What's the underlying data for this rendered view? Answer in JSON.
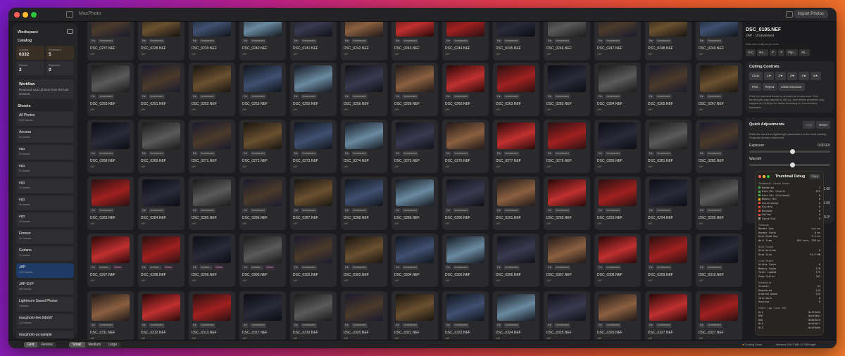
{
  "app": {
    "title": "MacPhoto",
    "import_label": "Import Photos"
  },
  "sidebar": {
    "workspace_title": "Workspace",
    "catalog_title": "Catalog",
    "stats": [
      {
        "label": "Loaded",
        "value": "6332"
      },
      {
        "label": "Reviewed",
        "value": "5"
      },
      {
        "label": "Picked",
        "value": "2"
      },
      {
        "label": "Rejected",
        "value": "0"
      }
    ],
    "workflow": {
      "title": "Workflow",
      "text": "Restored 6332 photos from the last session."
    },
    "shoots_title": "Shoots",
    "shoots": [
      {
        "name": "All Photos",
        "count": "6332 frames"
      },
      {
        "name": "Ancona",
        "count": "54 frames"
      },
      {
        "name": "exp",
        "count": "29 frames"
      },
      {
        "name": "exp",
        "count": "22 frames"
      },
      {
        "name": "exp",
        "count": "12 frames"
      },
      {
        "name": "exp",
        "count": "31 frames"
      },
      {
        "name": "exp",
        "count": "23 frames"
      },
      {
        "name": "Firenze",
        "count": "117 frames"
      },
      {
        "name": "Godano",
        "count": "21 frames"
      },
      {
        "name": "JAP",
        "count": "1013 frames"
      },
      {
        "name": "JAP-EXP",
        "count": "390 frames"
      },
      {
        "name": "Lightroom Saved Photos",
        "count": "4 frames"
      },
      {
        "name": "macphoto-live-5dnhl7",
        "count": "122 frames"
      },
      {
        "name": "macphoto-ux-sample",
        "count": "4 frames"
      }
    ]
  },
  "grid": {
    "status_label": "Unreviewed",
    "status_short": "Unrevie...",
    "rating_label": "0★",
    "edited_label": "Edited",
    "shoot_label": "JAP",
    "rows": [
      [
        "DSC_0237.NEF",
        "DSC_0238.NEF",
        "DSC_0239.NEF",
        "DSC_0240.NEF",
        "DSC_0241.NEF",
        "DSC_0242.NEF",
        "DSC_0243.NEF",
        "DSC_0244.NEF",
        "DSC_0245.NEF",
        "DSC_0246.NEF",
        "DSC_0247.NEF",
        "DSC_0248.NEF",
        "DSC_0249.NEF"
      ],
      [
        "DSC_0250.NEF",
        "DSC_0251.NEF",
        "DSC_0252.NEF",
        "DSC_0253.NEF",
        "DSC_0255.NEF",
        "DSC_0256.NEF",
        "DSC_0258.NEF",
        "DSC_0260.NEF",
        "DSC_0263.NEF",
        "DSC_0283.NEF",
        "DSC_0284.NEF",
        "DSC_0265.NEF",
        "DSC_0267.NEF"
      ],
      [
        "DSC_0268.NEF",
        "DSC_0269.NEF",
        "DSC_0271.NEF",
        "DSC_0272.NEF",
        "DSC_0273.NEF",
        "DSC_0274.NEF",
        "DSC_0275.NEF",
        "DSC_0276.NEF",
        "DSC_0277.NEF",
        "DSC_0279.NEF",
        "DSC_0280.NEF",
        "DSC_0281.NEF",
        "DSC_0282.NEF"
      ],
      [
        "DSC_0283.NEF",
        "DSC_0284.NEF",
        "DSC_0285.NEF",
        "DSC_0286.NEF",
        "DSC_0287.NEF",
        "DSC_0288.NEF",
        "DSC_0289.NEF",
        "DSC_0290.NEF",
        "DSC_0291.NEF",
        "DSC_0292.NEF",
        "DSC_0293.NEF",
        "DSC_0294.NEF",
        "DSC_0295.NEF"
      ],
      [
        "DSC_0297.NEF",
        "DSC_0298.NEF",
        "DSC_0299.NEF",
        "DSC_0300.NEF",
        "DSC_0302.NEF",
        "DSC_0303.NEF",
        "DSC_0304.NEF",
        "DSC_0305.NEF",
        "DSC_0306.NEF",
        "DSC_0307.NEF",
        "DSC_0308.NEF",
        "DSC_0309.NEF",
        "DSC_0310.NEF"
      ],
      [
        "DSC_0311.NEF",
        "DSC_0312.NEF",
        "DSC_0313.NEF",
        "DSC_0317.NEF",
        "DSC_0319.NEF",
        "DSC_0320.NEF",
        "DSC_0321.NEF",
        "DSC_0322.NEF",
        "DSC_0324.NEF",
        "DSC_0325.NEF",
        "DSC_0326.NEF",
        "DSC_0327.NEF",
        "DSC_0327.NEF"
      ]
    ],
    "edited_row": 4,
    "edited_cols": [
      0,
      1,
      2,
      3
    ]
  },
  "inspector": {
    "filename": "DSC_0195.NEF",
    "subtitle": "JAP · Unreviewed",
    "note": "Edits save locally as you work.",
    "actions": [
      "⟲ C",
      "Re...",
      "↶",
      "↷",
      "Flip...",
      "Fli..."
    ],
    "culling": {
      "title": "Culling Controls",
      "rating_buttons": [
        "Clear",
        "1★",
        "2★",
        "3★",
        "4★",
        "5★"
      ],
      "decision_buttons": [
        "Pick",
        "Reject",
        "Clear Decision"
      ],
      "note": "Only the selected frame is decoded at review size. Grid thumbnails stay capped at 450 px, and review previews stay capped at 2,048 px for faster browsing on low-memory hardware."
    },
    "quick": {
      "title": "Quick Adjustments",
      "auto_label": "Auto",
      "reset_label": "Reset",
      "note": "Edits are stored as lightweight parameters in the local catalog. Originals remain untouched.",
      "exposure_label": "Exposure",
      "exposure_value": "0.00 EV",
      "warmth_label": "Warmth",
      "extra_values": [
        "1.00",
        "1.00",
        "0.0°"
      ]
    }
  },
  "debug": {
    "title": "Thumbnail Debug",
    "copy_label": "Copy",
    "cache_title": "Thumbnail Cache State",
    "cache": [
      {
        "k": "Rendered",
        "v": "2",
        "c": "#4caf50"
      },
      {
        "k": "Disk Hit (Exact)",
        "v": "875",
        "c": "#4caf50"
      },
      {
        "k": "Disk Hit (Fallback)",
        "v": "0",
        "c": "#4caf50"
      },
      {
        "k": "Memory Hit",
        "v": "0",
        "c": "#ffc107"
      },
      {
        "k": "Invalidated",
        "v": "0",
        "c": "#f44336"
      },
      {
        "k": "Evicted",
        "v": "0",
        "c": "#f44336"
      },
      {
        "k": "Reloads",
        "v": "0",
        "c": "#f44336"
      },
      {
        "k": "Failed",
        "v": "0",
        "c": "#f44336"
      },
      {
        "k": "Cancelled",
        "v": "0",
        "c": "#9e9e9e"
      }
    ],
    "timings_title": "Timings",
    "timings": [
      {
        "k": "Render Avg",
        "v": "n/a ms"
      },
      {
        "k": "Render Total",
        "v": "0 ms"
      },
      {
        "k": "Disk Read Avg",
        "v": "3.3 ms"
      },
      {
        "k": "Wall Time",
        "v": "169 secs, 236 ms"
      }
    ],
    "disk_title": "Disk Cache",
    "disk": [
      {
        "k": "Disk Written",
        "v": "0"
      },
      {
        "k": "Disk Size",
        "v": "91.9 MB"
      }
    ],
    "live_title": "Live State",
    "live": [
      {
        "k": "Active Tasks",
        "v": "0"
      },
      {
        "k": "Memory Cache",
        "v": "179"
      },
      {
        "k": "Total Loaded",
        "v": "179"
      },
      {
        "k": "Pump Cycles",
        "v": "341"
      }
    ],
    "sched_title": "Scheduler",
    "sched": [
      {
        "k": "Visible",
        "v": "91"
      },
      {
        "k": "Requested",
        "v": "143"
      },
      {
        "k": "Ordered Queue",
        "v": "143"
      },
      {
        "k": "Idle Work",
        "v": "0"
      },
      {
        "k": "Running",
        "v": "0"
      }
    ],
    "log_title": "Event Log (last 50)",
    "log": [
      {
        "k": "HLI",
        "v": "0x713c83"
      },
      {
        "k": "DSK",
        "v": "0x6c5ba1"
      },
      {
        "k": "DSK",
        "v": "0x6b5c2e"
      },
      {
        "k": "HLI",
        "v": "0x5fd1c7"
      },
      {
        "k": "HLI",
        "v": "0x4f9d5e"
      }
    ]
  },
  "bottom": {
    "view_modes": [
      "Grid",
      "Review"
    ],
    "sizes": [
      "Small",
      "Medium",
      "Large"
    ],
    "cooling": "Cooling Down",
    "memory": "Memory 294.3 MB / 2 GB target"
  }
}
